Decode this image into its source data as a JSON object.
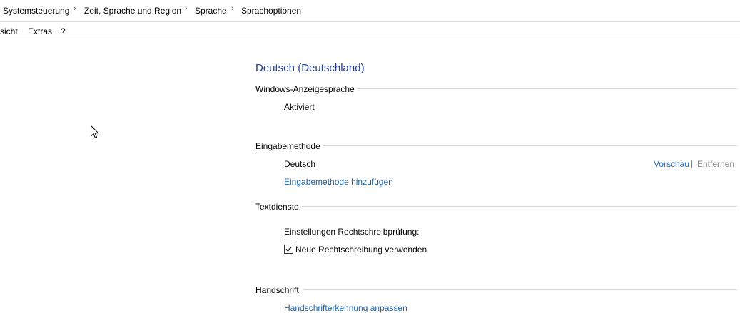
{
  "breadcrumb": {
    "items": [
      "Systemsteuerung",
      "Zeit, Sprache und Region",
      "Sprache",
      "Sprachoptionen"
    ],
    "separator": "›"
  },
  "menu": {
    "items": [
      "sicht",
      "Extras",
      "?"
    ]
  },
  "content": {
    "language_title": "Deutsch (Deutschland)",
    "display_language": {
      "title": "Windows-Anzeigesprache",
      "status": "Aktiviert"
    },
    "input_method": {
      "title": "Eingabemethode",
      "name": "Deutsch",
      "preview_link": "Vorschau",
      "pipe": "|",
      "remove_link": "Entfernen",
      "add_link": "Eingabemethode hinzufügen"
    },
    "text_services": {
      "title": "Textdienste",
      "spellcheck_label": "Einstellungen Rechtschreibprüfung:",
      "new_spelling_checkbox": "Neue Rechtschreibung verwenden",
      "new_spelling_checked": true
    },
    "handwriting": {
      "title": "Handschrift",
      "customize_link": "Handschrifterkennung anpassen"
    }
  },
  "colors": {
    "heading": "#1e3f8c",
    "link": "#1e63a8",
    "disabled": "#8a8a8a"
  }
}
